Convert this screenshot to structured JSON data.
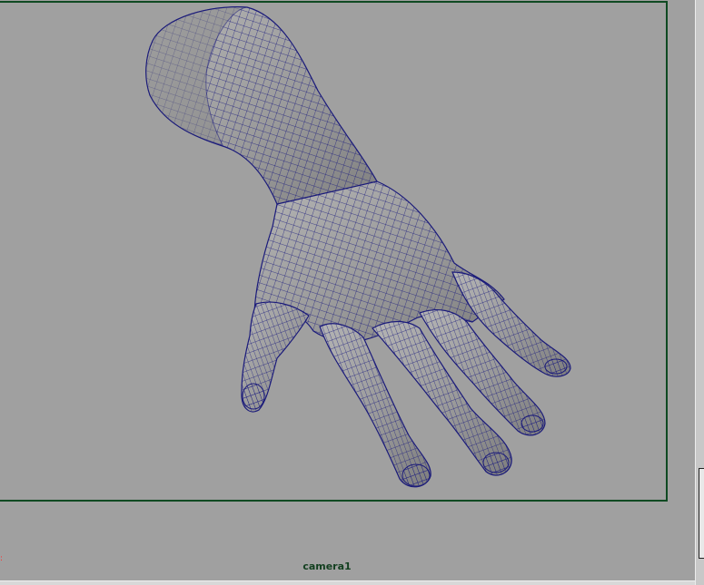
{
  "viewport": {
    "camera_name": "camera1",
    "background_color": "#a0a0a0",
    "gate_color": "#0f4a22",
    "wire_color": "#1a1a7a",
    "mesh_color": "#9a9a9a"
  },
  "icons": {
    "axis_indicator": "axis-indicator-icon"
  }
}
